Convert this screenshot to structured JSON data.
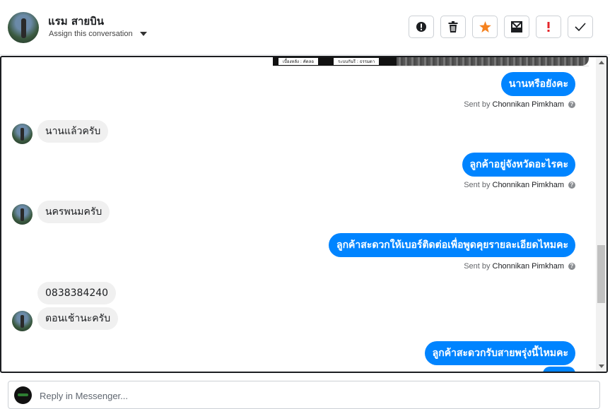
{
  "header": {
    "contact_name": "แรม สายบิน",
    "assign_label": "Assign this conversation",
    "toolbar": [
      {
        "name": "report-button",
        "icon": "alert-circle-icon"
      },
      {
        "name": "delete-button",
        "icon": "trash-icon"
      },
      {
        "name": "star-button",
        "icon": "star-icon",
        "color": "#f5821f"
      },
      {
        "name": "archive-button",
        "icon": "mail-box-icon"
      },
      {
        "name": "important-button",
        "icon": "exclamation-icon",
        "color": "#e4262a"
      },
      {
        "name": "done-button",
        "icon": "check-icon"
      }
    ]
  },
  "chat": {
    "banner_texts": [
      "เบื้องหลัง : คัดลอ",
      "ระบบกันรี : ธรรมดา"
    ],
    "messages": [
      {
        "dir": "out",
        "text": "นานหรือยังคะ",
        "sent_by_prefix": "Sent by",
        "sent_by_name": "Chonnikan Pimkham"
      },
      {
        "dir": "in",
        "text": "นานแล้วครับ"
      },
      {
        "dir": "out",
        "text": "ลูกค้าอยู่จังหวัดอะไรคะ",
        "sent_by_prefix": "Sent by",
        "sent_by_name": "Chonnikan Pimkham"
      },
      {
        "dir": "in",
        "text": "นครพนมครับ"
      },
      {
        "dir": "out",
        "text": "ลูกค้าสะดวกให้เบอร์ติดต่อเพื่อพูดคุยรายละเอียดไหมคะ",
        "sent_by_prefix": "Sent by",
        "sent_by_name": "Chonnikan Pimkham"
      },
      {
        "dir": "in",
        "text": "0838384240"
      },
      {
        "dir": "in",
        "text": "ตอนเช้านะครับ"
      },
      {
        "dir": "out",
        "text": "ลูกค้าสะดวกรับสายพรุ่งนี้ไหมคะ"
      }
    ]
  },
  "reply": {
    "placeholder": "Reply in Messenger..."
  },
  "colors": {
    "outgoing_bubble": "#0084ff",
    "incoming_bubble": "#f0f0f0",
    "star": "#f5821f",
    "important": "#e4262a"
  }
}
